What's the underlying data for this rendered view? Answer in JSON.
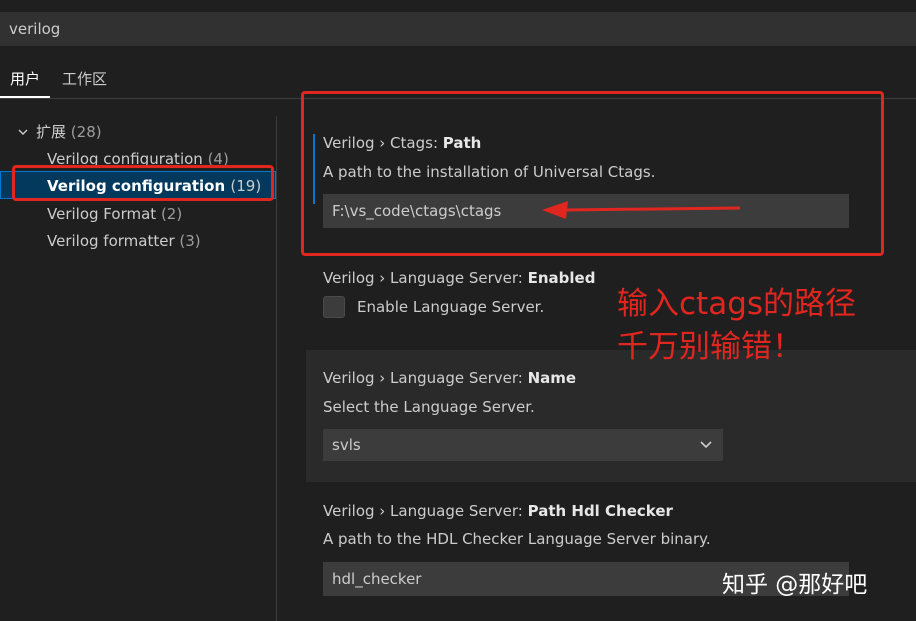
{
  "search": {
    "value": "verilog"
  },
  "tabs": [
    {
      "label": "用户"
    },
    {
      "label": "工作区"
    }
  ],
  "toc": {
    "group": {
      "label": "扩展",
      "count": "(28)"
    },
    "items": [
      {
        "label": "Verilog configuration",
        "count": "(4)"
      },
      {
        "label": "Verilog configuration",
        "count": "(19)"
      },
      {
        "label": "Verilog Format",
        "count": "(2)"
      },
      {
        "label": "Verilog formatter",
        "count": "(3)"
      }
    ]
  },
  "settings": {
    "ctags_path": {
      "prefix": "Verilog › Ctags: ",
      "name": "Path",
      "description": "A path to the installation of Universal Ctags.",
      "value": "F:\\vs_code\\ctags\\ctags"
    },
    "ls_enabled": {
      "prefix": "Verilog › Language Server: ",
      "name": "Enabled",
      "checkbox_label": "Enable Language Server."
    },
    "ls_name": {
      "prefix": "Verilog › Language Server: ",
      "name": "Name",
      "description": "Select the Language Server.",
      "value": "svls"
    },
    "ls_hdl_checker": {
      "prefix": "Verilog › Language Server: ",
      "name": "Path Hdl Checker",
      "description": "A path to the HDL Checker Language Server binary.",
      "value": "hdl_checker"
    }
  },
  "annotation": {
    "line1": "输入ctags的路径",
    "line2": "千万别输错！"
  },
  "watermark": "知乎 @那好吧",
  "colors": {
    "annotation": "#e0261f",
    "accent": "#0078d4",
    "background": "#1f1f1f"
  },
  "icons": {
    "toc_group": "chevron-down-icon",
    "select": "chevron-down-icon"
  }
}
